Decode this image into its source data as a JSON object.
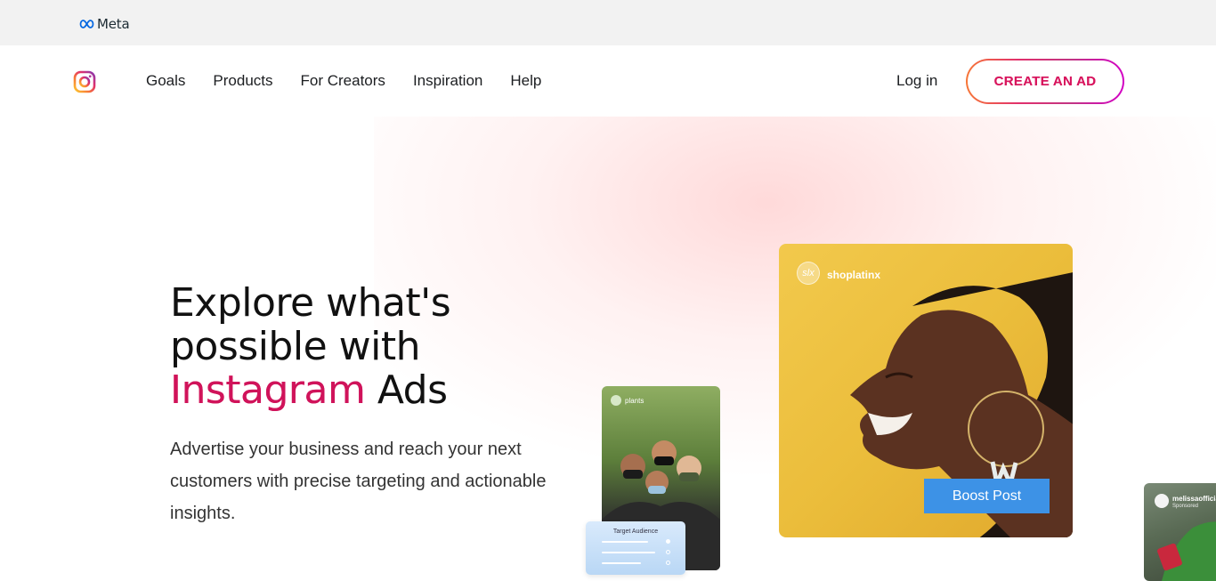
{
  "meta_bar": {
    "logo_text": "Meta"
  },
  "nav": {
    "links": [
      "Goals",
      "Products",
      "For Creators",
      "Inspiration",
      "Help"
    ],
    "login": "Log in",
    "cta": "CREATE AN AD"
  },
  "hero": {
    "title_line1": "Explore what's",
    "title_line2": "possible with",
    "title_highlight": "Instagram",
    "title_end": " Ads",
    "description": "Advertise your business and reach your next customers with precise targeting and actionable insights."
  },
  "cards": {
    "main_user": "shoplatinx",
    "main_avatar": "slx",
    "boost_label": "Boost Post",
    "small_user": "plants",
    "audience_title": "Target Audience",
    "right_user": "melissaofficial",
    "right_sub": "Sponsored"
  },
  "colors": {
    "accent_gradient_start": "#f77737",
    "accent_gradient_end": "#d300c5",
    "cta_text": "#d8155d",
    "boost_button": "#3d92e6"
  }
}
